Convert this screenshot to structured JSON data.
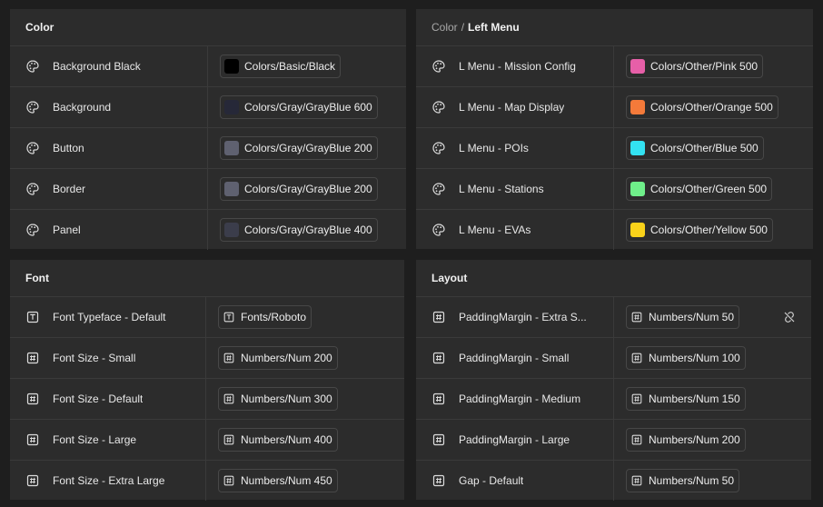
{
  "color_panel": {
    "title": "Color",
    "rows": [
      {
        "name": "Background Black",
        "value": "Colors/Basic/Black",
        "swatch": "#000000"
      },
      {
        "name": "Background",
        "value": "Colors/Gray/GrayBlue 600",
        "swatch": "#262838"
      },
      {
        "name": "Button",
        "value": "Colors/Gray/GrayBlue 200",
        "swatch": "#5f6170"
      },
      {
        "name": "Border",
        "value": "Colors/Gray/GrayBlue 200",
        "swatch": "#5f6170"
      },
      {
        "name": "Panel",
        "value": "Colors/Gray/GrayBlue 400",
        "swatch": "#3b3d4b"
      }
    ]
  },
  "lmenu_panel": {
    "title_prefix": "Color",
    "title_separator": "/",
    "title": "Left Menu",
    "rows": [
      {
        "name": "L Menu - Mission Config",
        "value": "Colors/Other/Pink 500",
        "swatch": "#e75fa8"
      },
      {
        "name": "L Menu - Map Display",
        "value": "Colors/Other/Orange 500",
        "swatch": "#f47a3a"
      },
      {
        "name": "L Menu - POIs",
        "value": "Colors/Other/Blue 500",
        "swatch": "#33e2f2"
      },
      {
        "name": "L Menu - Stations",
        "value": "Colors/Other/Green 500",
        "swatch": "#6fef8a"
      },
      {
        "name": "L Menu - EVAs",
        "value": "Colors/Other/Yellow 500",
        "swatch": "#f9d21a"
      }
    ]
  },
  "font_panel": {
    "title": "Font",
    "rows": [
      {
        "name": "Font Typeface - Default",
        "value": "Fonts/Roboto",
        "icon": "text-icon"
      },
      {
        "name": "Font Size - Small",
        "value": "Numbers/Num 200",
        "icon": "number-icon"
      },
      {
        "name": "Font Size - Default",
        "value": "Numbers/Num 300",
        "icon": "number-icon"
      },
      {
        "name": "Font Size - Large",
        "value": "Numbers/Num 400",
        "icon": "number-icon"
      },
      {
        "name": "Font Size - Extra Large",
        "value": "Numbers/Num 450",
        "icon": "number-icon"
      }
    ]
  },
  "layout_panel": {
    "title": "Layout",
    "rows": [
      {
        "name": "PaddingMargin - Extra S...",
        "value": "Numbers/Num 50",
        "icon": "number-icon",
        "action_icon": "detach-link-icon"
      },
      {
        "name": "PaddingMargin - Small",
        "value": "Numbers/Num 100",
        "icon": "number-icon"
      },
      {
        "name": "PaddingMargin - Medium",
        "value": "Numbers/Num 150",
        "icon": "number-icon"
      },
      {
        "name": "PaddingMargin - Large",
        "value": "Numbers/Num 200",
        "icon": "number-icon"
      },
      {
        "name": "Gap - Default",
        "value": "Numbers/Num 50",
        "icon": "number-icon"
      }
    ]
  }
}
